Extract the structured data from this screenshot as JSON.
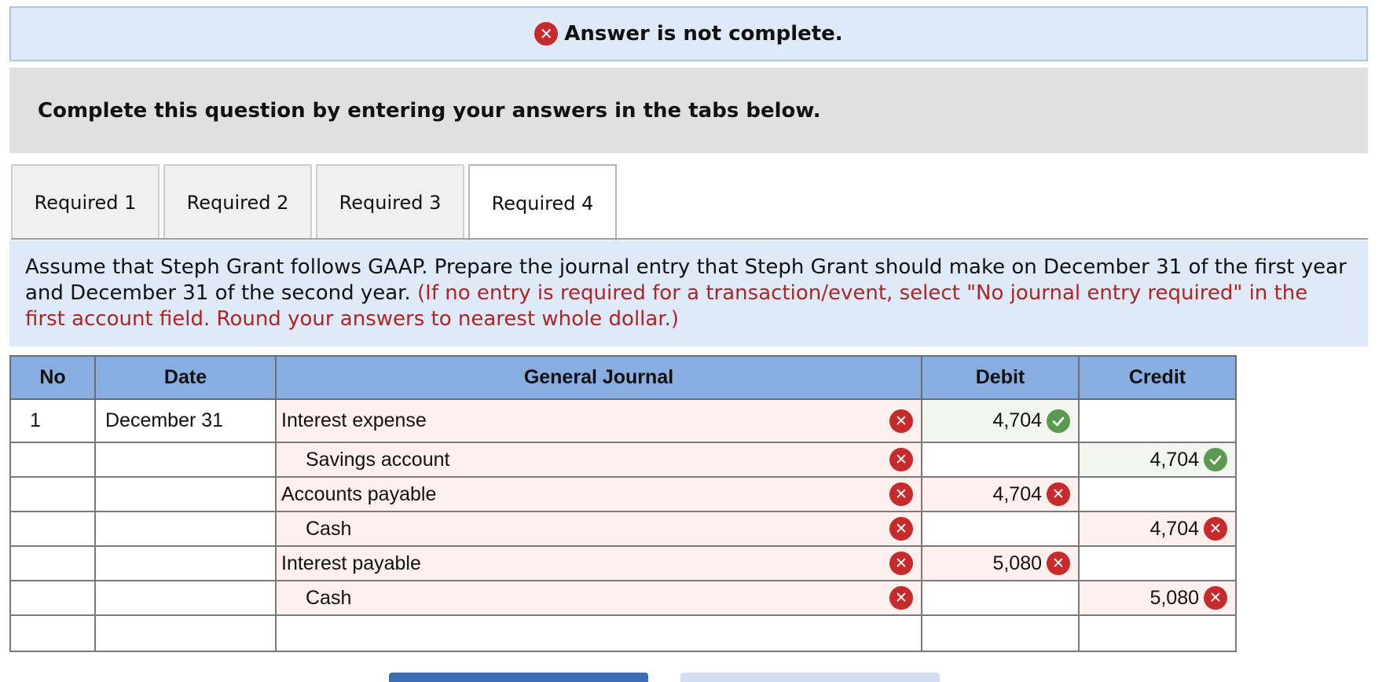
{
  "banner": {
    "text": "Answer is not complete.",
    "icon": "error-x-icon"
  },
  "instruction": "Complete this question by entering your answers in the tabs below.",
  "tabs": [
    {
      "label": "Required 1",
      "active": false
    },
    {
      "label": "Required 2",
      "active": false
    },
    {
      "label": "Required 3",
      "active": false
    },
    {
      "label": "Required 4",
      "active": true
    }
  ],
  "question": {
    "text": "Assume that Steph Grant follows GAAP. Prepare the journal entry that Steph Grant should make on December 31 of the first year and December 31 of the second year.",
    "hint": "(If no entry is required for a transaction/event, select \"No journal entry required\" in the first account field. Round your answers to nearest whole dollar.)"
  },
  "journal": {
    "headers": {
      "no": "No",
      "date": "Date",
      "account": "General Journal",
      "debit": "Debit",
      "credit": "Credit"
    },
    "rows": [
      {
        "no": "1",
        "date": "December 31",
        "account": "Interest expense",
        "indent": false,
        "account_status": "incorrect",
        "debit": "4,704",
        "debit_status": "correct",
        "credit": "",
        "credit_status": ""
      },
      {
        "no": "",
        "date": "",
        "account": "Savings account",
        "indent": true,
        "account_status": "incorrect",
        "debit": "",
        "debit_status": "",
        "credit": "4,704",
        "credit_status": "correct"
      },
      {
        "no": "",
        "date": "",
        "account": "Accounts payable",
        "indent": false,
        "account_status": "incorrect",
        "debit": "4,704",
        "debit_status": "incorrect",
        "credit": "",
        "credit_status": ""
      },
      {
        "no": "",
        "date": "",
        "account": "Cash",
        "indent": true,
        "account_status": "incorrect",
        "debit": "",
        "debit_status": "",
        "credit": "4,704",
        "credit_status": "incorrect"
      },
      {
        "no": "",
        "date": "",
        "account": "Interest payable",
        "indent": false,
        "account_status": "incorrect",
        "debit": "5,080",
        "debit_status": "incorrect",
        "credit": "",
        "credit_status": ""
      },
      {
        "no": "",
        "date": "",
        "account": "Cash",
        "indent": true,
        "account_status": "incorrect",
        "debit": "",
        "debit_status": "",
        "credit": "5,080",
        "credit_status": "incorrect"
      },
      {
        "no": "",
        "date": "",
        "account": "",
        "indent": false,
        "account_status": "",
        "debit": "",
        "debit_status": "",
        "credit": "",
        "credit_status": ""
      }
    ]
  },
  "colors": {
    "banner_bg": "#deeaf7",
    "header_bg": "#88ade0",
    "error_red": "#c62a2a",
    "correct_green": "#5a9a4e",
    "hint_red": "#b02424"
  }
}
